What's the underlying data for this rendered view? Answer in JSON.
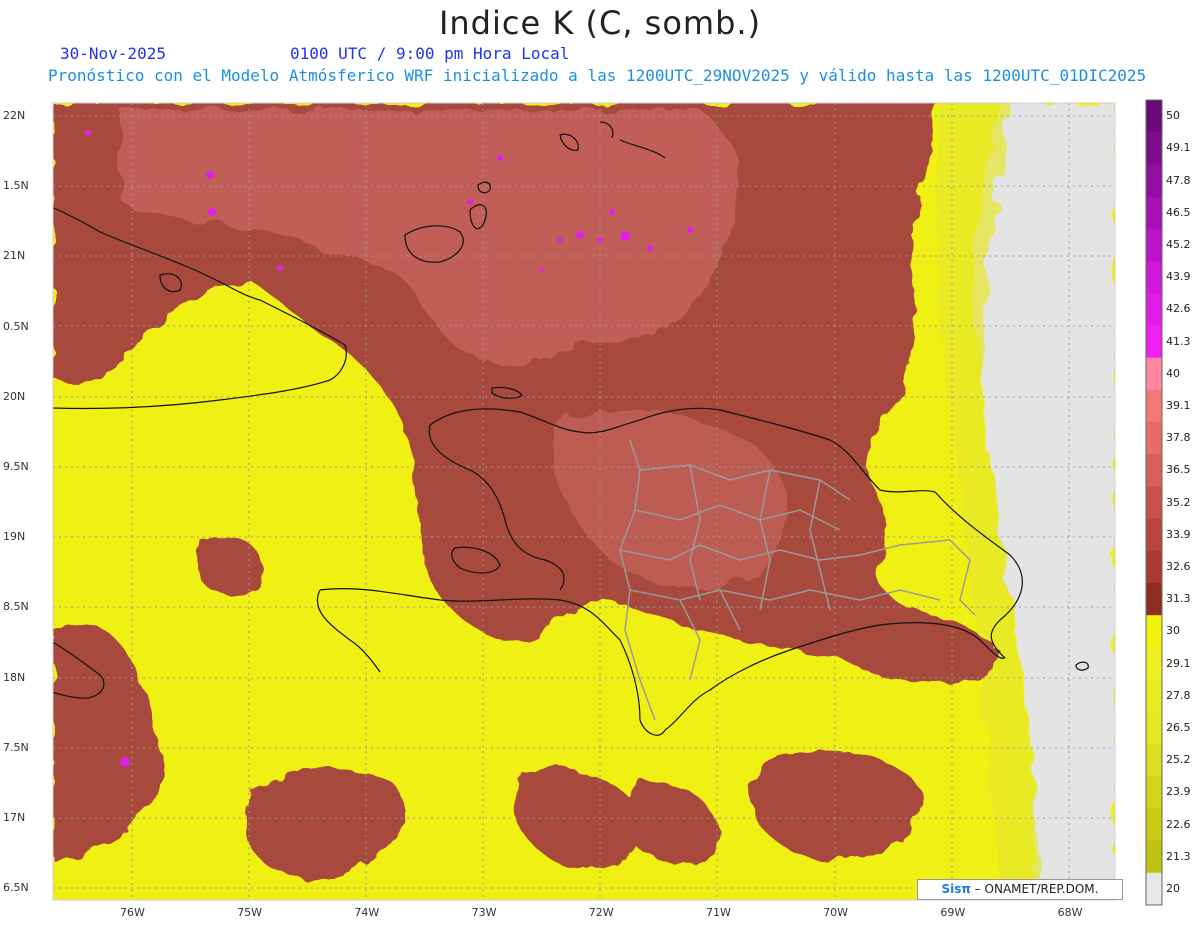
{
  "header": {
    "title": "Indice K (C, somb.)",
    "date": "30-Nov-2025",
    "time": "0100 UTC / 9:00 pm Hora Local",
    "subtitle": "Pronóstico con el Modelo Atmósferico WRF inicializado a las 1200UTC_29NOV2025 y válido hasta las  1200UTC_01DIC2025"
  },
  "lat_labels": [
    "22N",
    "1.5N",
    "21N",
    "0.5N",
    "20N",
    "9.5N",
    "19N",
    "8.5N",
    "18N",
    "7.5N",
    "17N",
    "6.5N"
  ],
  "lon_labels": [
    "76W",
    "75W",
    "74W",
    "73W",
    "72W",
    "71W",
    "70W",
    "69W",
    "68W"
  ],
  "colorbar": {
    "labels": [
      "50",
      "49.1",
      "47.8",
      "46.5",
      "45.2",
      "43.9",
      "42.6",
      "41.3",
      "40",
      "39.1",
      "37.8",
      "36.5",
      "35.2",
      "33.9",
      "32.6",
      "31.3",
      "30",
      "29.1",
      "27.8",
      "26.5",
      "25.2",
      "23.9",
      "22.6",
      "21.3",
      "20"
    ],
    "colors": [
      "#6a0a78",
      "#7d0c8c",
      "#900ea0",
      "#a610b4",
      "#bb14c8",
      "#d018d8",
      "#e01ce8",
      "#f020f4",
      "#ff88a0",
      "#f47878",
      "#e86a6a",
      "#d85e5a",
      "#c8504c",
      "#b8443e",
      "#a83a32",
      "#8e2e22",
      "#f2f20a",
      "#eef020",
      "#e8ec22",
      "#e2e824",
      "#dcde20",
      "#d2d418",
      "#c8cc14",
      "#bcc410",
      "#e8e8e8"
    ]
  },
  "credit": {
    "brand": "Sisπ",
    "text": " – ONAMET/REP.DOM."
  }
}
